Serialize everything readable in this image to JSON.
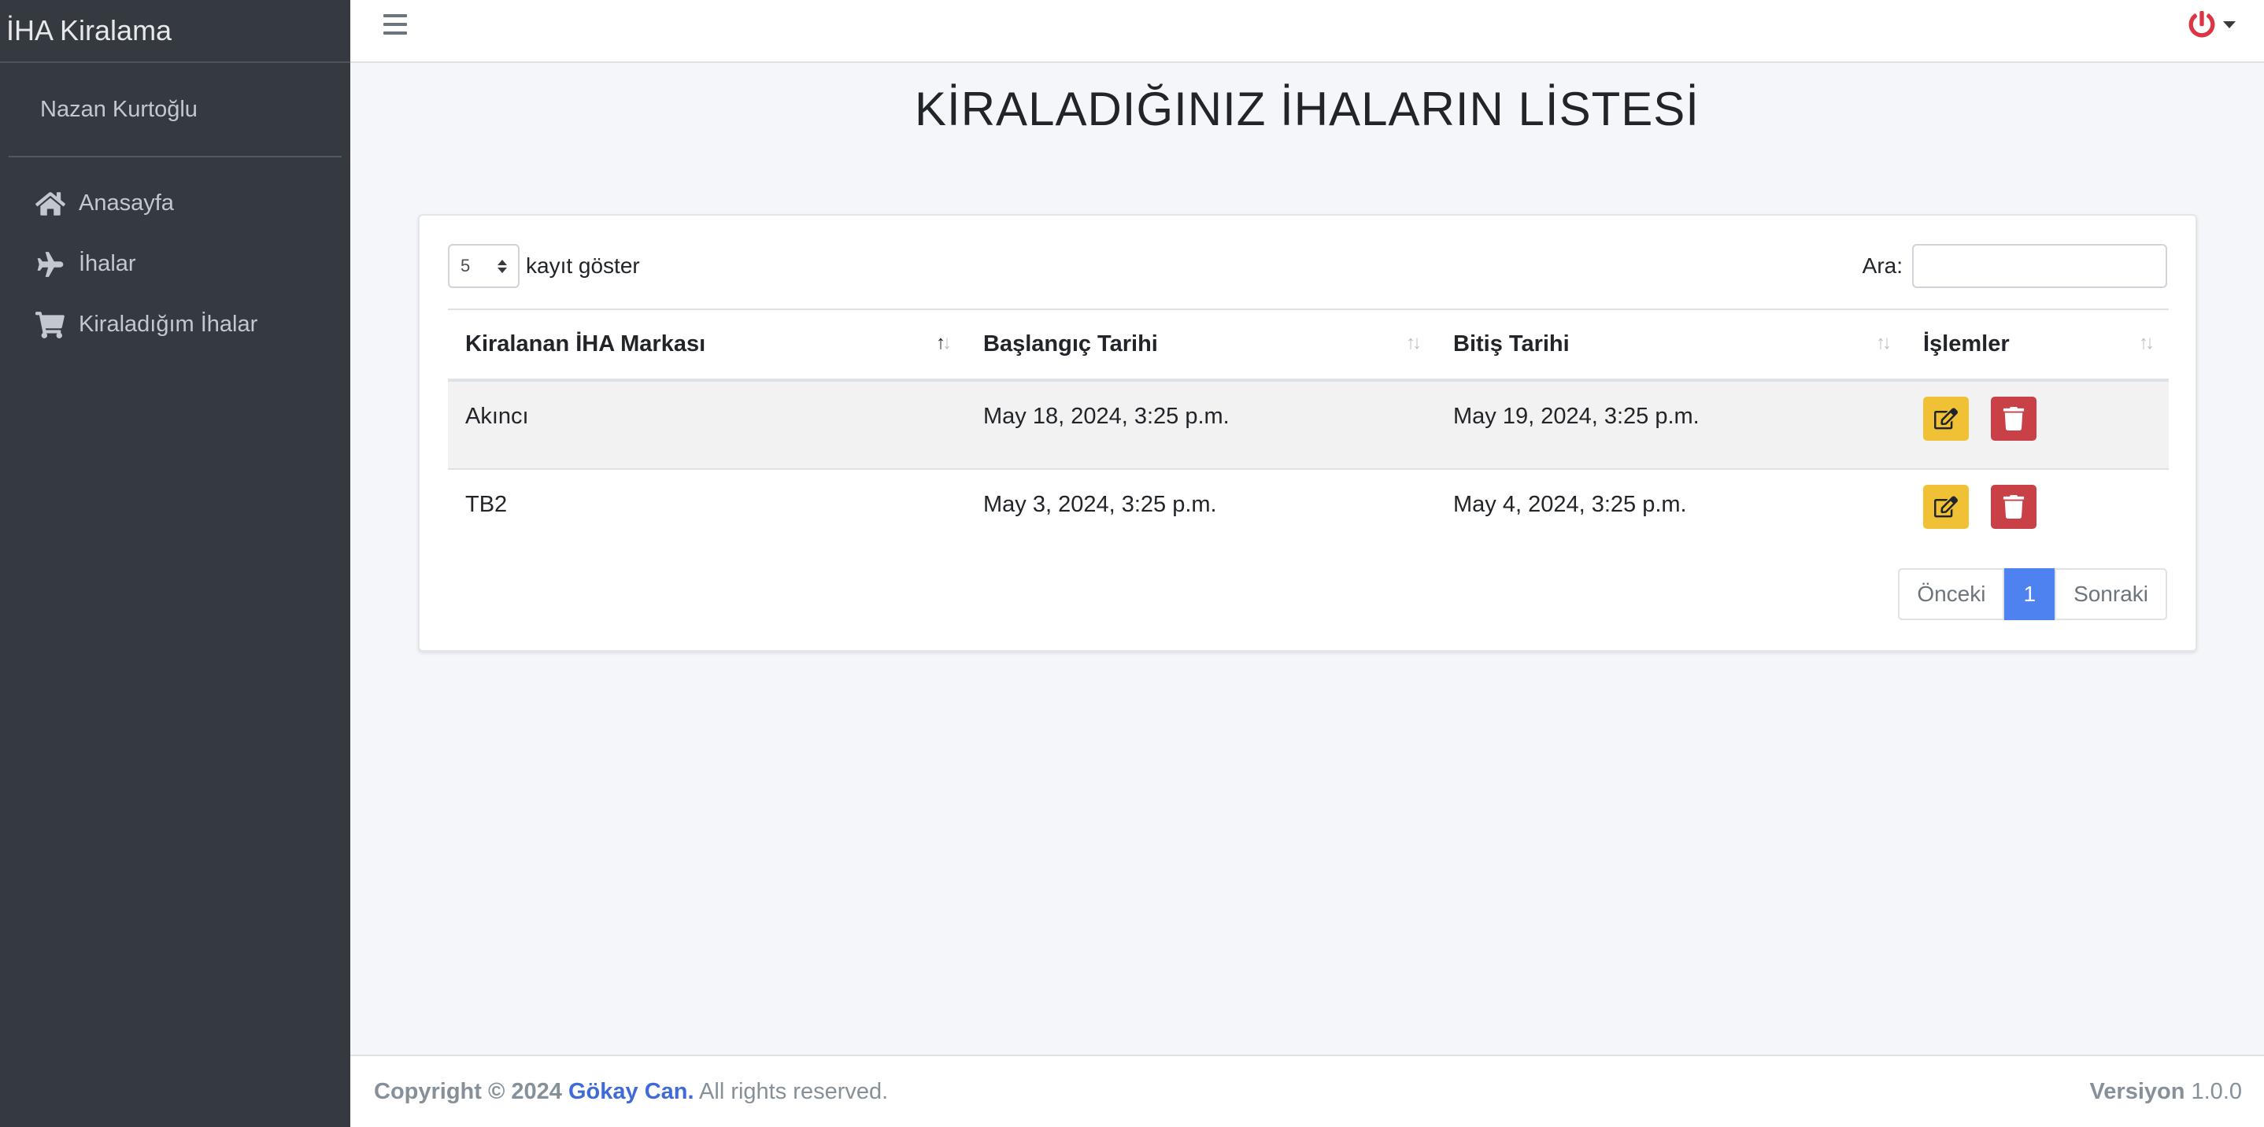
{
  "sidebar": {
    "brand": "İHA Kiralama",
    "user": "Nazan Kurtoğlu",
    "items": [
      {
        "label": "Anasayfa",
        "icon": "home-icon"
      },
      {
        "label": "İhalar",
        "icon": "plane-icon"
      },
      {
        "label": "Kiraladığım İhalar",
        "icon": "cart-icon"
      }
    ]
  },
  "header": {
    "title": "KİRALADIĞINIZ İHALARIN LİSTESİ"
  },
  "table_controls": {
    "page_length": "5",
    "length_label": "kayıt göster",
    "search_label": "Ara:",
    "search_value": ""
  },
  "table": {
    "columns": [
      "Kiralanan İHA Markası",
      "Başlangıç Tarihi",
      "Bitiş Tarihi",
      "İşlemler"
    ],
    "rows": [
      {
        "brand": "Akıncı",
        "start": "May 18, 2024, 3:25 p.m.",
        "end": "May 19, 2024, 3:25 p.m."
      },
      {
        "brand": "TB2",
        "start": "May 3, 2024, 3:25 p.m.",
        "end": "May 4, 2024, 3:25 p.m."
      }
    ]
  },
  "pagination": {
    "prev": "Önceki",
    "current": "1",
    "next": "Sonraki"
  },
  "footer": {
    "copyright_prefix": "Copyright © 2024",
    "author": "Gökay Can.",
    "rights": "All rights reserved.",
    "version_label": "Versiyon",
    "version": "1.0.0"
  },
  "colors": {
    "sidebar_bg": "#343a40",
    "edit_button": "#f0c135",
    "delete_button": "#c94046",
    "pagination_active": "#4e82f0",
    "power_icon": "#dc3545"
  }
}
